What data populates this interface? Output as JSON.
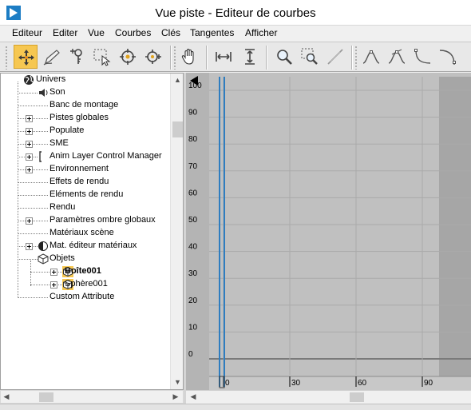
{
  "window": {
    "title": "Vue piste - Editeur de courbes"
  },
  "menu": [
    "Editeur",
    "Editer",
    "Vue",
    "Courbes",
    "Clés",
    "Tangentes",
    "Afficher"
  ],
  "toolbar": {
    "buttons": [
      {
        "name": "move-keys-icon",
        "active": true
      },
      {
        "name": "draw-curves-icon",
        "active": false
      },
      {
        "name": "add-keys-icon",
        "active": false
      },
      {
        "name": "region-select-icon",
        "active": false
      },
      {
        "name": "retime-icon",
        "active": false
      },
      {
        "name": "retime-all-icon",
        "active": false
      },
      {
        "name": "pan-icon",
        "active": false
      },
      {
        "name": "frame-horizontal-icon",
        "active": false
      },
      {
        "name": "frame-vertical-icon",
        "active": false
      },
      {
        "name": "zoom-icon",
        "active": false
      },
      {
        "name": "zoom-region-icon",
        "active": false
      },
      {
        "name": "isolate-curve-icon",
        "active": false
      },
      {
        "name": "tangent-auto-icon",
        "active": false
      },
      {
        "name": "tangent-custom-icon",
        "active": false
      },
      {
        "name": "tangent-fast-icon",
        "active": false
      },
      {
        "name": "tangent-slow-icon",
        "active": false
      }
    ]
  },
  "tree": [
    {
      "label": "Univers",
      "depth": 0,
      "icon": "globe-icon",
      "expander": false,
      "bold": false
    },
    {
      "label": "Son",
      "depth": 1,
      "icon": "speaker-icon",
      "expander": false,
      "bold": false
    },
    {
      "label": "Banc de montage",
      "depth": 1,
      "icon": "",
      "expander": false,
      "bold": false
    },
    {
      "label": "Pistes globales",
      "depth": 1,
      "icon": "",
      "expander": true,
      "bold": false
    },
    {
      "label": "Populate",
      "depth": 1,
      "icon": "",
      "expander": true,
      "bold": false
    },
    {
      "label": "SME",
      "depth": 1,
      "icon": "",
      "expander": true,
      "bold": false
    },
    {
      "label": "Anim Layer Control Manager",
      "depth": 1,
      "icon": "bracket-icon",
      "expander": true,
      "bold": false
    },
    {
      "label": "Environnement",
      "depth": 1,
      "icon": "",
      "expander": true,
      "bold": false
    },
    {
      "label": "Effets de rendu",
      "depth": 1,
      "icon": "",
      "expander": false,
      "bold": false
    },
    {
      "label": "Eléments de rendu",
      "depth": 1,
      "icon": "",
      "expander": false,
      "bold": false
    },
    {
      "label": "Rendu",
      "depth": 1,
      "icon": "",
      "expander": false,
      "bold": false
    },
    {
      "label": "Paramètres ombre globaux",
      "depth": 1,
      "icon": "",
      "expander": true,
      "bold": false
    },
    {
      "label": "Matériaux scène",
      "depth": 1,
      "icon": "",
      "expander": false,
      "bold": false
    },
    {
      "label": "Mat. éditeur matériaux",
      "depth": 1,
      "icon": "material-sphere-icon",
      "expander": true,
      "bold": false
    },
    {
      "label": "Objets",
      "depth": 1,
      "icon": "object-cube-icon",
      "expander": false,
      "bold": false
    },
    {
      "label": "Boîte001",
      "depth": 2,
      "icon": "object-cube-highlight-icon",
      "expander": true,
      "bold": true
    },
    {
      "label": "Sphère001",
      "depth": 2,
      "icon": "object-cube-highlight-icon",
      "expander": true,
      "bold": false
    },
    {
      "label": "Custom Attribute",
      "depth": 1,
      "icon": "",
      "expander": false,
      "bold": false
    }
  ],
  "curve_editor": {
    "y_ticks": [
      "100",
      "90",
      "80",
      "70",
      "60",
      "50",
      "40",
      "30",
      "20",
      "10",
      "0"
    ],
    "x_ticks": [
      "0",
      "30",
      "60",
      "90"
    ],
    "colors": {
      "background": "#c0c0c0",
      "inactive_range": "#a6a6a6",
      "grid": "#aaaaaa",
      "time_slider": "#2e7dc0",
      "active_button": "#f6c751"
    }
  }
}
